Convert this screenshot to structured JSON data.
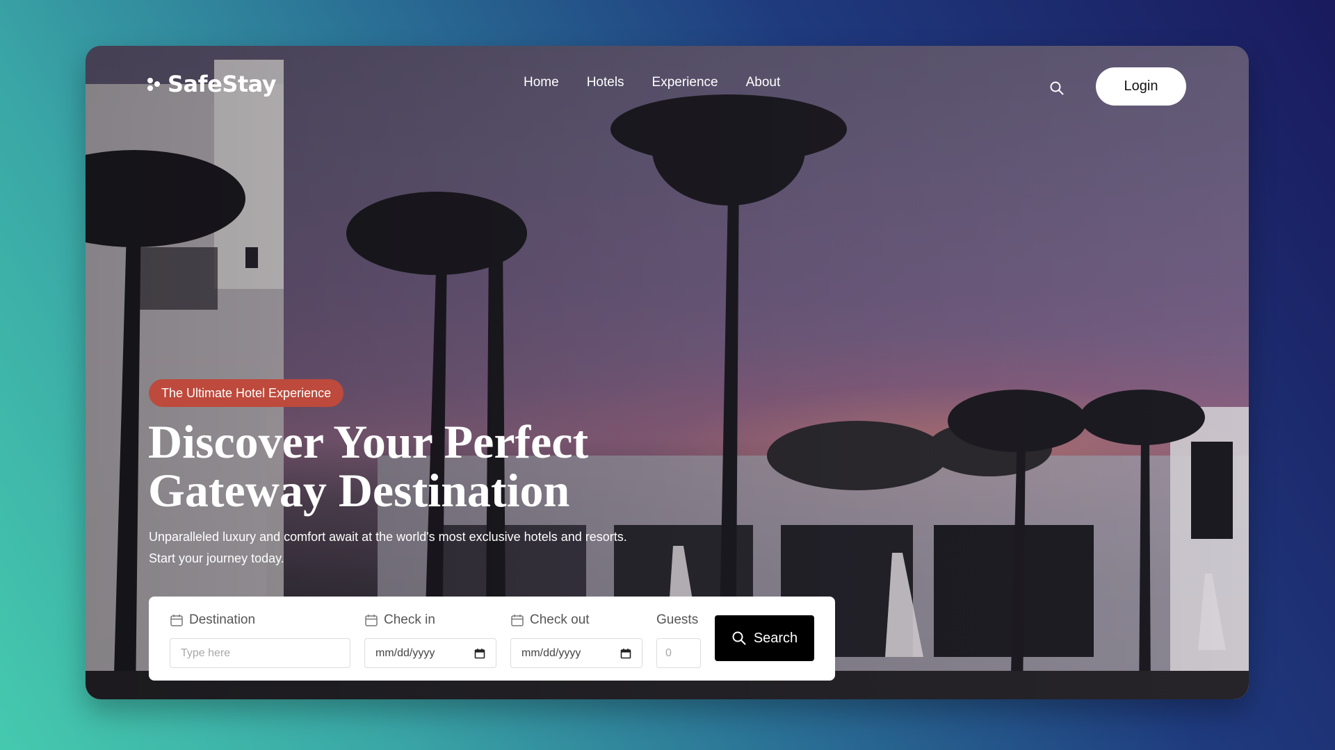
{
  "brand": {
    "name": "SafeStay"
  },
  "nav": {
    "items": [
      {
        "label": "Home"
      },
      {
        "label": "Hotels"
      },
      {
        "label": "Experience"
      },
      {
        "label": "About"
      }
    ],
    "search_icon": "search-icon",
    "login_label": "Login"
  },
  "hero": {
    "badge": "The Ultimate Hotel Experience",
    "title_line1": "Discover Your Perfect",
    "title_line2": "Gateway Destination",
    "subtitle": "Unparalleled luxury and comfort await at the world's most exclusive hotels and resorts. Start your journey today."
  },
  "booking": {
    "destination": {
      "label": "Destination",
      "placeholder": "Type here",
      "icon": "calendar-icon"
    },
    "check_in": {
      "label": "Check in",
      "value": "mm/dd/yyyy",
      "icon": "calendar-icon"
    },
    "check_out": {
      "label": "Check out",
      "value": "mm/dd/yyyy",
      "icon": "calendar-icon"
    },
    "guests": {
      "label": "Guests",
      "placeholder": "0"
    },
    "search_label": "Search",
    "search_icon": "search-icon"
  },
  "colors": {
    "badge": "#bd4a3c",
    "search_button": "#000000",
    "login_button": "#ffffff"
  }
}
